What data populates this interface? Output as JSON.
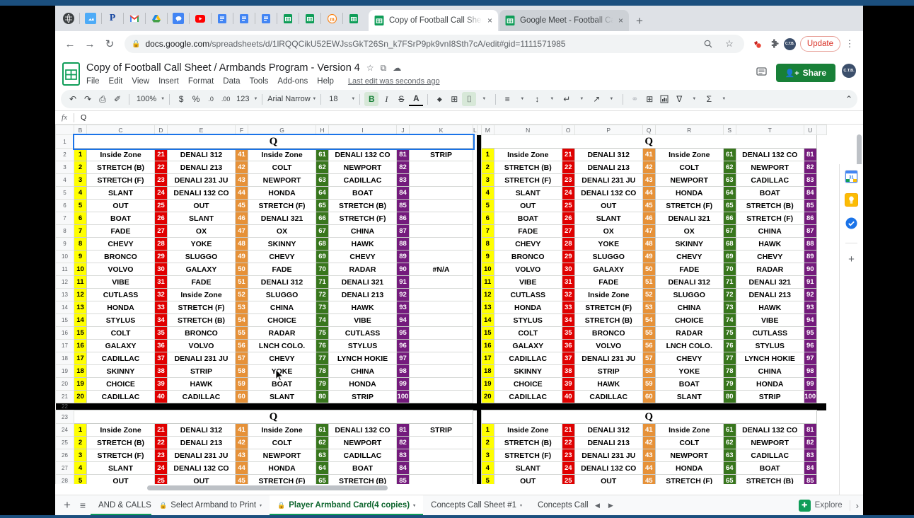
{
  "browser": {
    "bookmark_icons": [
      "globe-icon",
      "drive-photo-icon",
      "paypal-icon",
      "gmail-icon",
      "google-drive-icon",
      "chat-icon",
      "youtube-icon",
      "docs-icon",
      "docs-icon-2",
      "docs-icon-3",
      "sheets-icon",
      "sheets-icon-2",
      "moodle-icon",
      "sheets-icon-3"
    ],
    "tabs": [
      {
        "label": "Copy of Football Call Sheet / A",
        "active": true,
        "close_label": "×"
      },
      {
        "label": "Google Meet - Football Call Sh",
        "active": false,
        "close_label": "×"
      }
    ],
    "new_tab_label": "+",
    "nav": {
      "back": "←",
      "forward": "→",
      "reload": "↻"
    },
    "url_prefix": "docs.google.com",
    "url_suffix": "/spreadsheets/d/1lRQQCikU52EWJssGkT26Sn_k7FSrP9pk9vnI8Sth7cA/edit#gid=1111571985",
    "lock_icon": "lock-icon",
    "search_icon": "search-icon",
    "star_icon": "star-icon",
    "extension_icons": [
      "ublock-icon",
      "puzzle-icon"
    ],
    "profile_initials": "C.T.B.",
    "update_label": "Update",
    "menu_label": "⋮"
  },
  "app": {
    "doc_title": "Copy of Football Call Sheet / Armbands Program - Version 4",
    "star": "☆",
    "move": "⧉",
    "cloud": "☁",
    "menus": [
      "File",
      "Edit",
      "View",
      "Insert",
      "Format",
      "Data",
      "Tools",
      "Add-ons",
      "Help"
    ],
    "last_edit": "Last edit was seconds ago",
    "comment_icon": "comment-history-icon",
    "share_label": "Share",
    "share_icon": "person-add-icon",
    "account_initials": "C.T.B."
  },
  "toolbar": {
    "undo": "↶",
    "redo": "↷",
    "print": "⎙",
    "paint": "✐",
    "zoom": "100%",
    "currency": "$",
    "percent": "%",
    "dec_less": ".0",
    "dec_more": ".00",
    "formats": "123",
    "font": "Arial Narrow",
    "font_size": "18",
    "bold": "B",
    "italic": "I",
    "strike": "S",
    "text_color": "A",
    "fill": "◆",
    "borders": "⊞",
    "merge": "⌷",
    "align": "≡",
    "valign": "↕",
    "wrap": "↵",
    "rotate": "↗",
    "link": "⚭",
    "comment_insert": "⊞",
    "chart": "Ὄa",
    "filter": "∇",
    "functions": "Σ",
    "collapse": "⌃"
  },
  "formula_bar": {
    "fx": "fx",
    "value": "Q"
  },
  "grid": {
    "columns_left": [
      "",
      "C",
      "D",
      "E",
      "F",
      "G",
      "H",
      "I",
      "J",
      "K",
      "L"
    ],
    "columns_right": [
      "M",
      "N",
      "O",
      "P",
      "Q",
      "R",
      "S",
      "T",
      "U"
    ],
    "row_numbers": [
      "1",
      "2",
      "3",
      "4",
      "5",
      "6",
      "7",
      "8",
      "9",
      "10",
      "11",
      "12",
      "13",
      "14",
      "15",
      "16",
      "17",
      "18",
      "19",
      "20",
      "21",
      "22",
      "23",
      "24",
      "25",
      "26",
      "27",
      "28"
    ],
    "section_header": "Q",
    "selected_cell_value": "Q",
    "na_value": "#N/A",
    "extra_col_k": [
      "STRIP",
      "",
      "",
      "",
      "",
      "",
      "",
      "",
      "",
      "#N/A",
      "",
      "",
      "",
      "",
      "",
      "",
      "",
      "",
      "",
      ""
    ],
    "chart_data": {
      "type": "table",
      "title": "Q",
      "colors": {
        "group1": "#ffff00",
        "group2": "#e00000",
        "group3": "#e69138",
        "group4": "#38761d",
        "group5": "#741b7c"
      },
      "columns": [
        {
          "num_start": 1,
          "color_key": "group1",
          "plays": [
            "Inside Zone",
            "STRETCH (B)",
            "STRETCH (F)",
            "SLANT",
            "OUT",
            "BOAT",
            "FADE",
            "CHEVY",
            "BRONCO",
            "VOLVO",
            "VIBE",
            "CUTLASS",
            "HONDA",
            "STYLUS",
            "COLT",
            "GALAXY",
            "CADILLAC",
            "SKINNY",
            "CHOICE",
            "CADILLAC"
          ]
        },
        {
          "num_start": 21,
          "color_key": "group2",
          "plays": [
            "DENALI 312",
            "DENALI 213",
            "DENALI 231 JU",
            "DENALI 132 CO",
            "OUT",
            "SLANT",
            "OX",
            "YOKE",
            "SLUGGO",
            "GALAXY",
            "FADE",
            "Inside Zone",
            "STRETCH (F)",
            "STRETCH (B)",
            "BRONCO",
            "VOLVO",
            "DENALI 231 JU",
            "STRIP",
            "HAWK",
            "CADILLAC"
          ]
        },
        {
          "num_start": 41,
          "color_key": "group3",
          "plays": [
            "Inside Zone",
            "COLT",
            "NEWPORT",
            "HONDA",
            "STRETCH (F)",
            "DENALI 321",
            "OX",
            "SKINNY",
            "CHEVY",
            "FADE",
            "DENALI 312",
            "SLUGGO",
            "CHINA",
            "CHOICE",
            "RADAR",
            "LNCH COLO.",
            "CHEVY",
            "YOKE",
            "BOAT",
            "SLANT"
          ]
        },
        {
          "num_start": 61,
          "color_key": "group4",
          "plays": [
            "DENALI 132 CO",
            "NEWPORT",
            "CADILLAC",
            "BOAT",
            "STRETCH (B)",
            "STRETCH (F)",
            "CHINA",
            "HAWK",
            "CHEVY",
            "RADAR",
            "DENALI 321",
            "DENALI 213",
            "HAWK",
            "VIBE",
            "CUTLASS",
            "STYLUS",
            "LYNCH HOKIE",
            "CHINA",
            "HONDA",
            "STRIP"
          ]
        },
        {
          "num_start": 81,
          "color_key": "group5",
          "plays": [
            "",
            "",
            "",
            "",
            "",
            "",
            "",
            "",
            "",
            "",
            "",
            "",
            "",
            "",
            "",
            "",
            "",
            "",
            "",
            ""
          ]
        }
      ]
    }
  },
  "sheet_tabs": {
    "add_label": "+",
    "all_sheets_label": "≡",
    "tabs": [
      {
        "label": "AND & CALLSHEET Creator",
        "locked": false,
        "active": false,
        "caret": "▾",
        "clipped": true
      },
      {
        "label": "Select Armband to Print",
        "locked": true,
        "lock_style": "grey",
        "active": false,
        "caret": "▾"
      },
      {
        "label": "Player Armband Card(4 copies)",
        "locked": true,
        "lock_style": "green",
        "active": true,
        "caret": "▾"
      },
      {
        "label": "Concepts Call Sheet #1",
        "locked": false,
        "active": false,
        "caret": "▾"
      },
      {
        "label": "Concepts Call She",
        "locked": false,
        "active": false,
        "caret": "",
        "clipped": true
      }
    ],
    "prev_arrow": "◀",
    "next_arrow": "▶",
    "explore_label": "Explore",
    "explore_icon": "explore-icon",
    "chevron": "›"
  },
  "rail": {
    "icons": [
      {
        "name": "google-calendar-icon",
        "glyph": "31",
        "color": "#1a73e8"
      },
      {
        "name": "google-keep-icon",
        "glyph": "□",
        "color": "#f9ab00"
      },
      {
        "name": "google-tasks-icon",
        "glyph": "✓",
        "color": "#1a73e8"
      }
    ],
    "plus_label": "+"
  }
}
